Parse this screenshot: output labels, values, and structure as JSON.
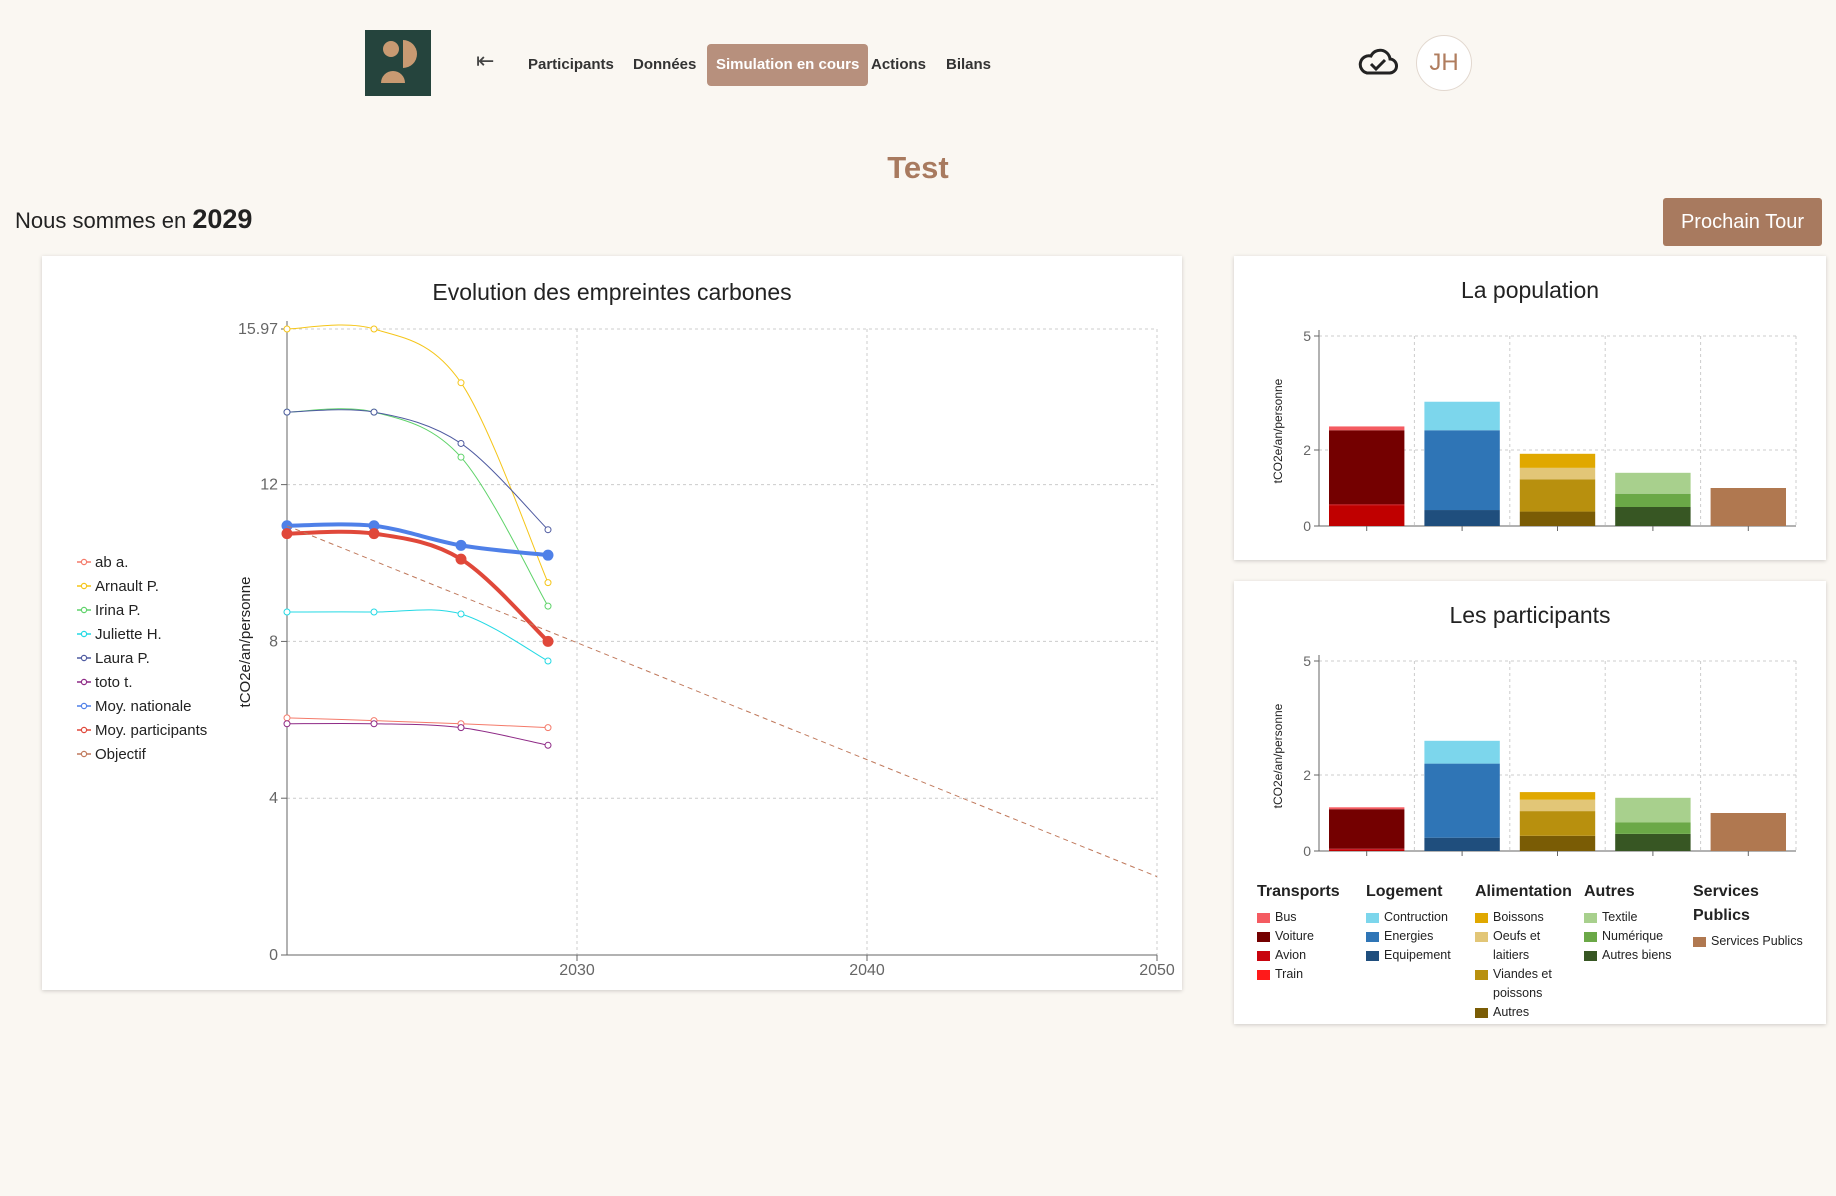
{
  "nav": {
    "items": [
      {
        "label": "Participants",
        "active": false
      },
      {
        "label": "Données",
        "active": false
      },
      {
        "label": "Simulation en cours",
        "active": true
      },
      {
        "label": "Actions",
        "active": false
      },
      {
        "label": "Bilans",
        "active": false
      }
    ],
    "back_icon": "arrow-left-bar-icon",
    "sync_icon": "cloud-check-icon",
    "avatar_initials": "JH"
  },
  "page": {
    "title": "Test",
    "year_prefix": "Nous sommes en",
    "year": "2029",
    "next_button": "Prochain Tour"
  },
  "colors": {
    "accent": "#a87a5f",
    "logo_bg": "#25443d",
    "logo_fg": "#c89a72"
  },
  "chart_data": [
    {
      "type": "line",
      "title": "Evolution des empreintes carbones",
      "ylabel": "tCO2e/an/personne",
      "xlim": [
        2020,
        2050
      ],
      "ylim": [
        0,
        15.97
      ],
      "yticks": [
        0,
        4,
        8,
        12,
        15.97
      ],
      "xticks": [
        2030,
        2040,
        2050
      ],
      "grid": true,
      "legend_position": "left",
      "series": [
        {
          "name": "ab a.",
          "color": "#f47a6a",
          "width": 1,
          "x": [
            2020,
            2023,
            2026,
            2029
          ],
          "values": [
            6.05,
            5.98,
            5.9,
            5.8
          ]
        },
        {
          "name": "Arnault P.",
          "color": "#f5c518",
          "width": 1,
          "x": [
            2020,
            2023,
            2026,
            2029
          ],
          "values": [
            15.97,
            15.97,
            14.6,
            9.5
          ]
        },
        {
          "name": "Irina P.",
          "color": "#5fd36a",
          "width": 1,
          "x": [
            2020,
            2023,
            2026,
            2029
          ],
          "values": [
            13.85,
            13.85,
            12.7,
            8.9
          ]
        },
        {
          "name": "Juliette H.",
          "color": "#23d9e4",
          "width": 1,
          "x": [
            2020,
            2023,
            2026,
            2029
          ],
          "values": [
            8.75,
            8.75,
            8.7,
            7.5
          ]
        },
        {
          "name": "Laura P.",
          "color": "#4e5aa0",
          "width": 1,
          "x": [
            2020,
            2023,
            2026,
            2029
          ],
          "values": [
            13.85,
            13.85,
            13.05,
            10.85
          ]
        },
        {
          "name": "toto t.",
          "color": "#8e2a86",
          "width": 1,
          "x": [
            2020,
            2023,
            2026,
            2029
          ],
          "values": [
            5.9,
            5.9,
            5.8,
            5.35
          ]
        },
        {
          "name": "Moy. nationale",
          "color": "#4f80e8",
          "width": 4,
          "x": [
            2020,
            2023,
            2026,
            2029
          ],
          "values": [
            10.95,
            10.95,
            10.45,
            10.2
          ]
        },
        {
          "name": "Moy. participants",
          "color": "#e0483a",
          "width": 4,
          "x": [
            2020,
            2023,
            2026,
            2029
          ],
          "values": [
            10.75,
            10.75,
            10.1,
            8.0
          ]
        },
        {
          "name": "Objectif",
          "color": "#c0795c",
          "width": 1,
          "dashed": true,
          "x": [
            2020,
            2050
          ],
          "values": [
            10.95,
            2.0
          ]
        }
      ]
    },
    {
      "type": "bar",
      "stacked": true,
      "title": "La population",
      "ylabel": "tCO2e/an/personne",
      "ylim": [
        0,
        5
      ],
      "yticks": [
        0,
        2,
        5
      ],
      "categories": [
        "Transports",
        "Logement",
        "Alimentation",
        "Autres",
        "Services Publics"
      ],
      "stacks": [
        [
          {
            "name": "Train",
            "value": 0.55
          },
          {
            "name": "Avion",
            "value": 0.02
          },
          {
            "name": "Voiture",
            "value": 1.95
          },
          {
            "name": "Bus",
            "value": 0.1
          }
        ],
        [
          {
            "name": "Equipement",
            "value": 0.42
          },
          {
            "name": "Energies",
            "value": 2.1
          },
          {
            "name": "Contruction",
            "value": 0.75
          }
        ],
        [
          {
            "name": "Autres",
            "value": 0.38
          },
          {
            "name": "Viandes et poissons",
            "value": 0.85
          },
          {
            "name": "Oeufs et laitiers",
            "value": 0.3
          },
          {
            "name": "Boissons",
            "value": 0.37
          }
        ],
        [
          {
            "name": "Autres biens",
            "value": 0.5
          },
          {
            "name": "Numérique",
            "value": 0.35
          },
          {
            "name": "Textile",
            "value": 0.55
          }
        ],
        [
          {
            "name": "Services Publics",
            "value": 1.0
          }
        ]
      ]
    },
    {
      "type": "bar",
      "stacked": true,
      "title": "Les participants",
      "ylabel": "tCO2e/an/personne",
      "ylim": [
        0,
        5
      ],
      "yticks": [
        0,
        2,
        5
      ],
      "categories": [
        "Transports",
        "Logement",
        "Alimentation",
        "Autres",
        "Services Publics"
      ],
      "stacks": [
        [
          {
            "name": "Train",
            "value": 0.03
          },
          {
            "name": "Avion",
            "value": 0.03
          },
          {
            "name": "Voiture",
            "value": 1.04
          },
          {
            "name": "Bus",
            "value": 0.05
          }
        ],
        [
          {
            "name": "Equipement",
            "value": 0.35
          },
          {
            "name": "Energies",
            "value": 1.95
          },
          {
            "name": "Contruction",
            "value": 0.6
          }
        ],
        [
          {
            "name": "Autres",
            "value": 0.4
          },
          {
            "name": "Viandes et poissons",
            "value": 0.65
          },
          {
            "name": "Oeufs et laitiers",
            "value": 0.3
          },
          {
            "name": "Boissons",
            "value": 0.2
          }
        ],
        [
          {
            "name": "Autres biens",
            "value": 0.45
          },
          {
            "name": "Numérique",
            "value": 0.3
          },
          {
            "name": "Textile",
            "value": 0.65
          }
        ],
        [
          {
            "name": "Services Publics",
            "value": 1.0
          }
        ]
      ]
    }
  ],
  "categories_legend": [
    {
      "title": "Transports",
      "items": [
        {
          "label": "Bus",
          "color": "#f45b61"
        },
        {
          "label": "Voiture",
          "color": "#740000"
        },
        {
          "label": "Avion",
          "color": "#c8040e"
        },
        {
          "label": "Train",
          "color": "#ff1a1a"
        }
      ]
    },
    {
      "title": "Logement",
      "items": [
        {
          "label": "Contruction",
          "color": "#7cd6ec"
        },
        {
          "label": "Energies",
          "color": "#2f75b6"
        },
        {
          "label": "Equipement",
          "color": "#1f4e7d"
        }
      ]
    },
    {
      "title": "Alimentation",
      "items": [
        {
          "label": "Boissons",
          "color": "#e0a800"
        },
        {
          "label": "Oeufs et laitiers",
          "color": "#e2c677"
        },
        {
          "label": "Viandes et poissons",
          "color": "#b8900e"
        },
        {
          "label": "Autres",
          "color": "#7a5c05"
        }
      ]
    },
    {
      "title": "Autres",
      "items": [
        {
          "label": "Textile",
          "color": "#a8d08d"
        },
        {
          "label": "Numérique",
          "color": "#6ba847"
        },
        {
          "label": "Autres biens",
          "color": "#375623"
        }
      ]
    },
    {
      "title": "Services Publics",
      "items": [
        {
          "label": "Services Publics",
          "color": "#b07850"
        }
      ]
    }
  ],
  "stack_colors": {
    "Bus": "#f45b61",
    "Voiture": "#740000",
    "Avion": "#c8040e",
    "Train": "#c00000",
    "Contruction": "#7cd6ec",
    "Energies": "#2f75b6",
    "Equipement": "#1f4e7d",
    "Boissons": "#e0a800",
    "Oeufs et laitiers": "#e2c677",
    "Viandes et poissons": "#b8900e",
    "Autres": "#7a5c05",
    "Textile": "#a8d08d",
    "Numérique": "#6ba847",
    "Autres biens": "#375623",
    "Services Publics": "#b07850"
  }
}
